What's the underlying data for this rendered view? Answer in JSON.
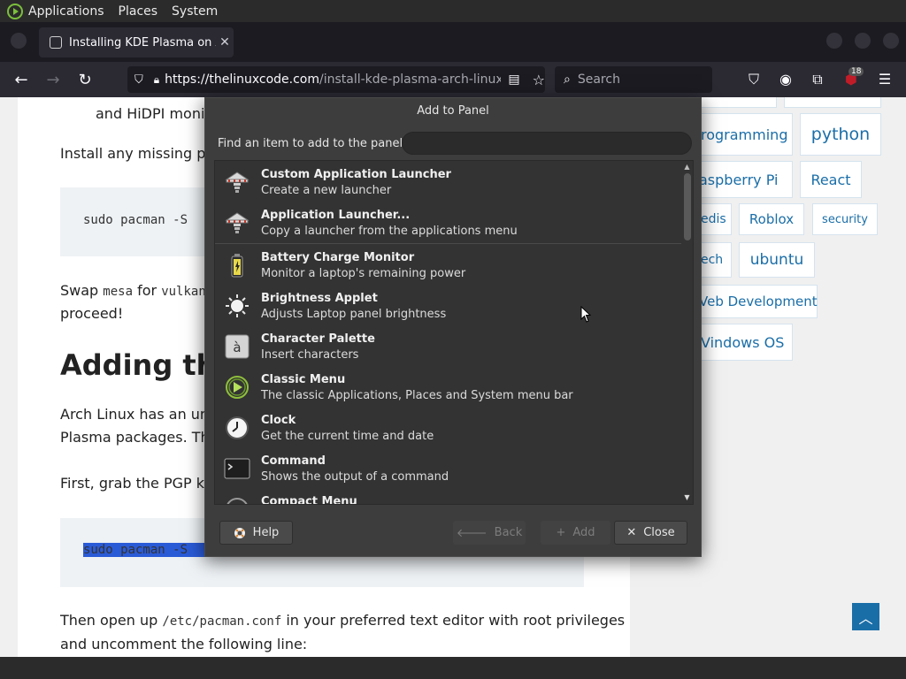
{
  "top_panel": {
    "items": [
      "Applications",
      "Places",
      "System"
    ]
  },
  "browser": {
    "tab_title": "Installing KDE Plasma on Ar",
    "tab_close": "✕",
    "url_host": "https://thelinuxcode.com",
    "url_path": "/install-kde-plasma-arch-linux/",
    "search_placeholder": "Search",
    "notification_count": "18"
  },
  "article": {
    "line_hidpi": "and HiDPI monito",
    "line_install": "Install any missing pack",
    "code1": "sudo pacman -S ",
    "swap_prefix": "Swap ",
    "swap_mono1": "mesa",
    "swap_mid": " for ",
    "swap_mono2": "vulkan-",
    "proceed": "proceed!",
    "heading": "Adding the",
    "arch_line1": "Arch Linux has an unoff",
    "arch_line2": "Plasma packages. This",
    "first_line": "First, grab the PGP keys",
    "code2": "sudo pacman -S ",
    "then_prefix": "Then open up ",
    "then_mono": "/etc/pacman.conf",
    "then_suffix": " in your preferred text editor with root privileges",
    "uncomment": "and uncomment the following line:"
  },
  "sidebar_tags": [
    "rogramming",
    "python",
    "aspberry Pi",
    "React",
    "edis",
    "Roblox",
    "security",
    "ech",
    "ubuntu",
    "Veb Development",
    "Vindows OS"
  ],
  "dialog": {
    "title": "Add to Panel",
    "find_label": "Find an item to add to the panel:",
    "find_value": "",
    "items": [
      {
        "name": "Custom Application Launcher",
        "desc": "Create a new launcher",
        "icon": "launcher-icon"
      },
      {
        "name": "Application Launcher...",
        "desc": "Copy a launcher from the applications menu",
        "icon": "launcher-icon"
      },
      {
        "name": "Battery Charge Monitor",
        "desc": "Monitor a laptop's remaining power",
        "icon": "battery-icon"
      },
      {
        "name": "Brightness Applet",
        "desc": "Adjusts Laptop panel brightness",
        "icon": "brightness-icon"
      },
      {
        "name": "Character Palette",
        "desc": "Insert characters",
        "icon": "character-palette-icon"
      },
      {
        "name": "Classic Menu",
        "desc": "The classic Applications, Places and System menu bar",
        "icon": "classic-menu-icon"
      },
      {
        "name": "Clock",
        "desc": "Get the current time and date",
        "icon": "clock-icon"
      },
      {
        "name": "Command",
        "desc": "Shows the output of a command",
        "icon": "terminal-icon"
      },
      {
        "name": "Compact Menu",
        "desc": "",
        "icon": "compact-menu-icon"
      }
    ],
    "help_label": "Help",
    "back_label": "Back",
    "add_label": "Add",
    "close_label": "Close"
  }
}
